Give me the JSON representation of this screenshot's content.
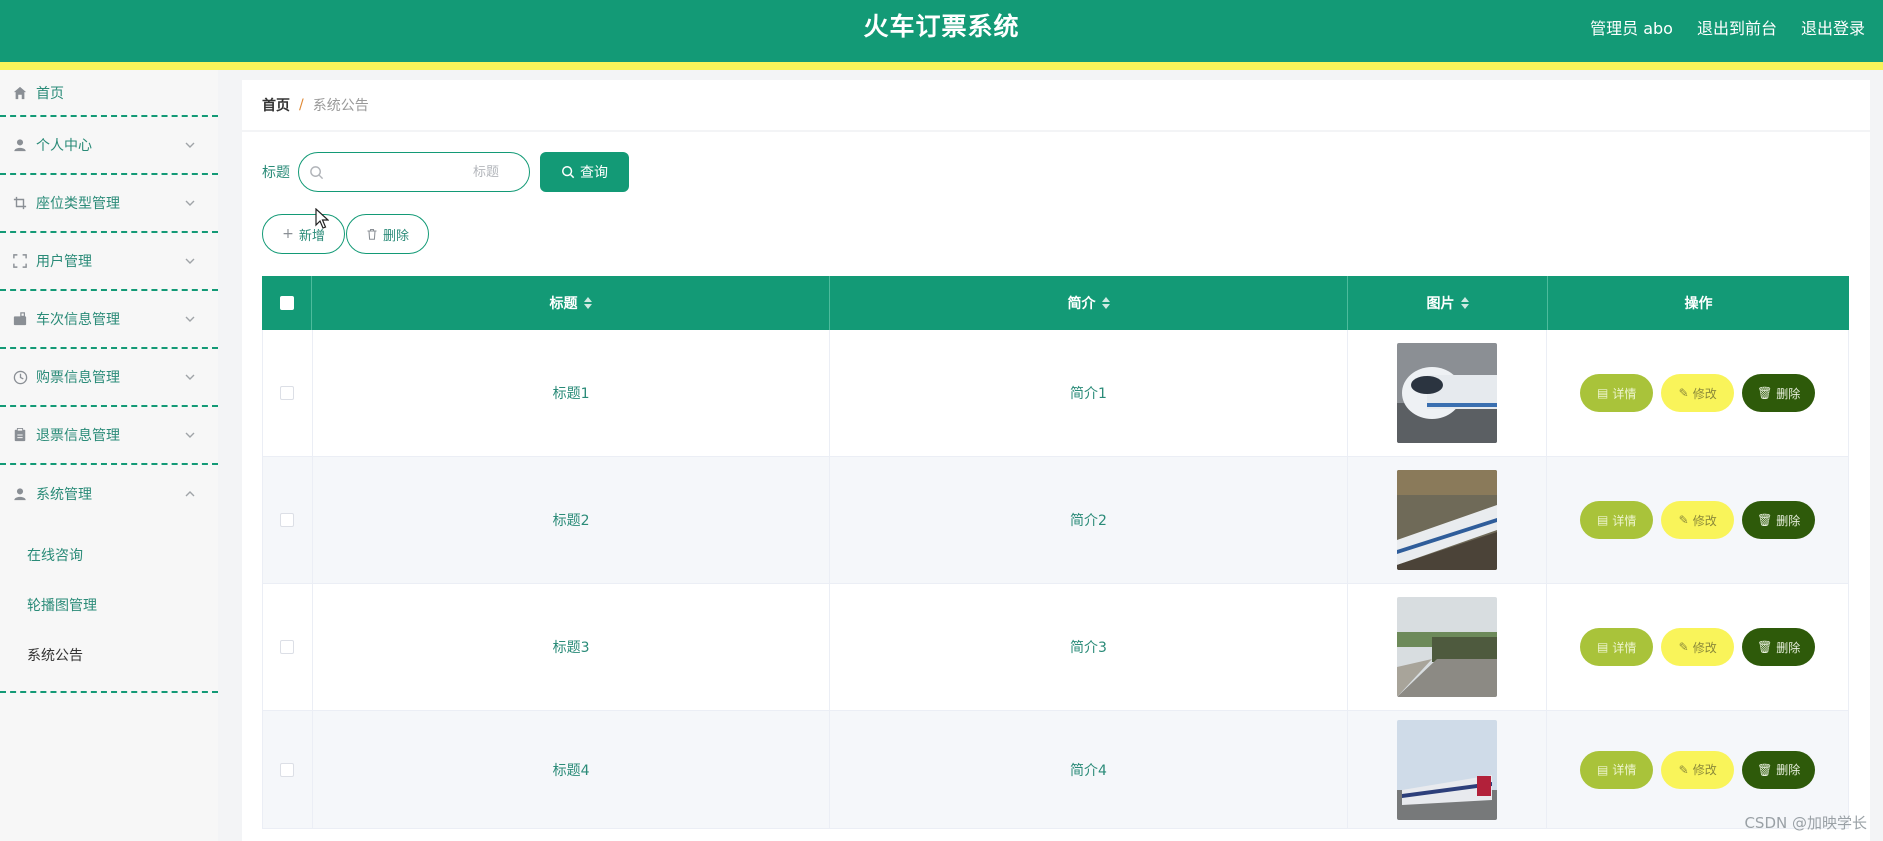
{
  "header": {
    "title": "火车订票系统",
    "admin_label": "管理员 abo",
    "to_front": "退出到前台",
    "logout": "退出登录",
    "colors": {
      "primary": "#139a76",
      "stripe": "#f9f45a"
    }
  },
  "sidebar": {
    "items": [
      {
        "label": "首页",
        "icon": "home-icon"
      },
      {
        "label": "个人中心",
        "icon": "user-icon"
      },
      {
        "label": "座位类型管理",
        "icon": "crop-icon"
      },
      {
        "label": "用户管理",
        "icon": "fullscreen-icon"
      },
      {
        "label": "车次信息管理",
        "icon": "suitcase-icon"
      },
      {
        "label": "购票信息管理",
        "icon": "clock-icon"
      },
      {
        "label": "退票信息管理",
        "icon": "clipboard-icon"
      },
      {
        "label": "系统管理",
        "icon": "user-icon"
      }
    ],
    "sub_items": [
      "在线咨询",
      "轮播图管理",
      "系统公告"
    ],
    "active_sub": "系统公告"
  },
  "breadcrumb": {
    "home": "首页",
    "separator": "/",
    "current": "系统公告"
  },
  "search": {
    "label": "标题",
    "placeholder": "标题",
    "value": "",
    "query_button": "查询"
  },
  "actions": {
    "add": "新增",
    "delete": "删除"
  },
  "table": {
    "columns": [
      "标题",
      "简介",
      "图片",
      "操作"
    ],
    "rows": [
      {
        "title": "标题1",
        "intro": "简介1"
      },
      {
        "title": "标题2",
        "intro": "简介2"
      },
      {
        "title": "标题3",
        "intro": "简介3"
      },
      {
        "title": "标题4",
        "intro": "简介4"
      }
    ],
    "row_actions": {
      "detail": "详情",
      "edit": "修改",
      "delete": "删除"
    }
  },
  "watermark": "CSDN @加映学长"
}
